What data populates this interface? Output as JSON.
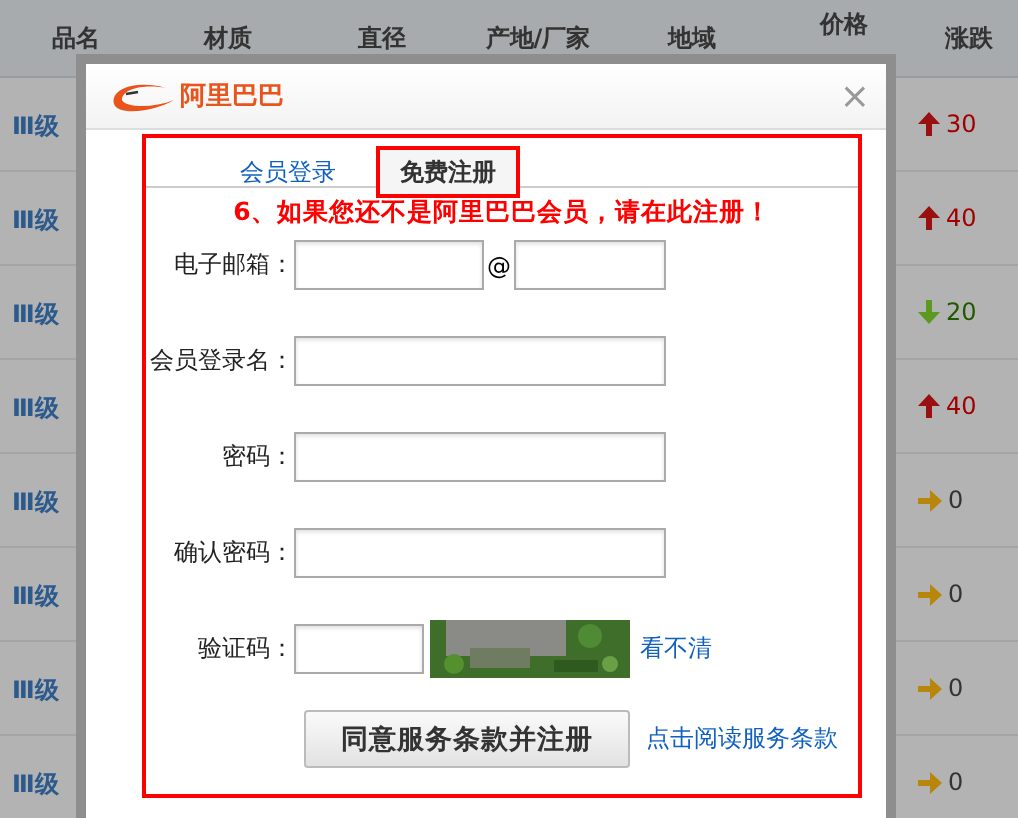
{
  "table": {
    "columns": [
      "品名",
      "材质",
      "直径",
      "产地/厂家",
      "地域",
      "价格",
      "涨跌"
    ],
    "rows": [
      {
        "name": "Ⅲ级",
        "change": "30",
        "kind": "up"
      },
      {
        "name": "Ⅲ级",
        "change": "40",
        "kind": "up"
      },
      {
        "name": "Ⅲ级",
        "change": "20",
        "kind": "down"
      },
      {
        "name": "Ⅲ级",
        "change": "40",
        "kind": "up"
      },
      {
        "name": "Ⅲ级",
        "change": "0",
        "kind": "flat"
      },
      {
        "name": "Ⅲ级",
        "change": "0",
        "kind": "flat"
      },
      {
        "name": "Ⅲ级",
        "change": "0",
        "kind": "flat"
      },
      {
        "name": "Ⅲ级",
        "change": "0",
        "kind": "flat"
      }
    ]
  },
  "dialog": {
    "logo": "阿里巴巴",
    "close": "×",
    "tabs": [
      {
        "label": "会员登录",
        "selected": false
      },
      {
        "label": "免费注册",
        "selected": true
      }
    ],
    "notice": "6、如果您还不是阿里巴巴会员，请在此注册！",
    "fields": [
      {
        "kind": "email",
        "label": "电子邮箱：",
        "at": "@"
      },
      {
        "kind": "text",
        "label": "会员登录名："
      },
      {
        "kind": "text",
        "label": "密码："
      },
      {
        "kind": "text",
        "label": "确认密码："
      },
      {
        "kind": "captcha",
        "label": "验证码：",
        "refresh": "看不清"
      }
    ],
    "submit": "同意服务条款并注册",
    "terms_link": "点击阅读服务条款"
  }
}
